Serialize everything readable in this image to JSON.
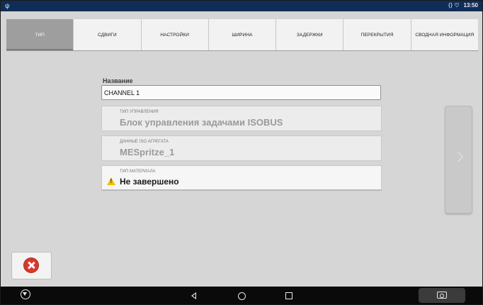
{
  "statusbar": {
    "time": "13:50",
    "signal_text": "⟨⟩ ♡",
    "usb_icon": "usb-icon"
  },
  "tabs": [
    {
      "label": "ТИП",
      "active": true
    },
    {
      "label": "СДВИГИ",
      "active": false
    },
    {
      "label": "НАСТРОЙКИ",
      "active": false
    },
    {
      "label": "ШИРИНА",
      "active": false
    },
    {
      "label": "ЗАДЕРЖКИ",
      "active": false
    },
    {
      "label": "ПЕРЕКРЫТИЯ",
      "active": false
    },
    {
      "label": "СВОДНАЯ ИНФОРМАЦИЯ",
      "active": false
    }
  ],
  "form": {
    "name_label": "Название",
    "name_value": "CHANNEL 1",
    "control_type": {
      "caption": "ТИП УПРАВЛЕНИЯ",
      "value": "Блок управления задачами ISOBUS"
    },
    "iso_data": {
      "caption": "ДАННЫЕ ISO АГРЕГАТА",
      "value": "MESpritze_1"
    },
    "material_type": {
      "caption": "ТИП МАТЕРИАЛА",
      "value": "Не завершено"
    }
  },
  "colors": {
    "statusbar_bg": "#0f2d56",
    "active_tab_bg": "#9e9e9e",
    "warning": "#f2c200",
    "cancel_red": "#d9382c",
    "navbar_bg": "#0a0a0a"
  }
}
